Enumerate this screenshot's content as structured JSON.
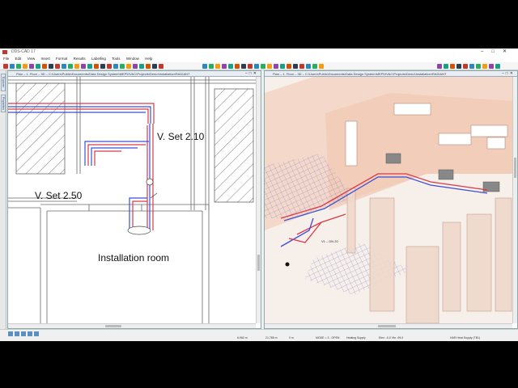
{
  "app": {
    "title": "DDS-CAD 17"
  },
  "menu": [
    "File",
    "Edit",
    "View",
    "Insert",
    "Format",
    "Results",
    "Labelling",
    "Tools",
    "Window",
    "Help"
  ],
  "left_tabs": [
    "Explorer",
    "Properties"
  ],
  "plan_view": {
    "title": "Plan – 1. Floor – 3D – C:\\Users\\Public\\Documents\\Data Design System\\MEP\\HVAC\\Projects\\Demo\\Installation\\RADIANT",
    "labels": {
      "vset_210": "V. Set 2.10",
      "vset_250": "V. Set 2.50",
      "room": "Installation room"
    }
  },
  "view_3d": {
    "title": "Plan – 1. Floor – 3D – C:\\Users\\Public\\Documents\\Data Design System\\MEP\\HVAC\\Projects\\Demo\\Installation\\RADIANT",
    "pipe_tag": "V1 – DN 20"
  },
  "status": {
    "x": "6,960 m",
    "y": "21,785 m",
    "z": "0 m",
    "mode": "MODE = 3 - OPEN",
    "system": "Heating Supply",
    "elev": "Elev: -0,0 Vbr -99,0",
    "layer": "HAR Heat Supply (TB1)"
  },
  "colors": {
    "supply": "#d93a4a",
    "return": "#3a4fd9",
    "wall": "#e8b89a",
    "hatch": "#555555"
  }
}
